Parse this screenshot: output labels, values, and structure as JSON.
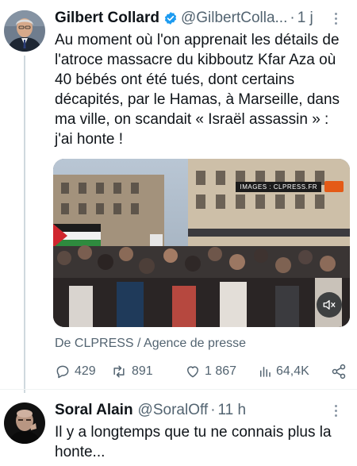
{
  "tweet1": {
    "name": "Gilbert Collard",
    "handle": "@GilbertColla...",
    "separator": "·",
    "time": "1 j",
    "text": "Au moment où l'on apprenait les détails de l'atroce massacre du kibboutz Kfar Aza où 40 bébés ont été tués, dont certains décapités, par le Hamas, à Marseille, dans ma ville, on scandait « Israël assassin » : j'ai honte !",
    "media": {
      "watermark": "IMAGES : CLPRESS.FR",
      "mute_icon": "speaker-muted-icon"
    },
    "source": "De CLPRESS / Agence de presse",
    "stats": {
      "replies": "429",
      "retweets": "891",
      "likes": "1 867",
      "views": "64,4K"
    }
  },
  "tweet2": {
    "name": "Soral Alain",
    "handle": "@SoralOff",
    "separator": "·",
    "time": "11 h",
    "text": "Il y a longtemps que tu ne connais plus la honte..."
  },
  "colors": {
    "text": "#0f1419",
    "secondary": "#536471",
    "verified": "#1d9bf0",
    "thread_line": "#cfd9de"
  }
}
